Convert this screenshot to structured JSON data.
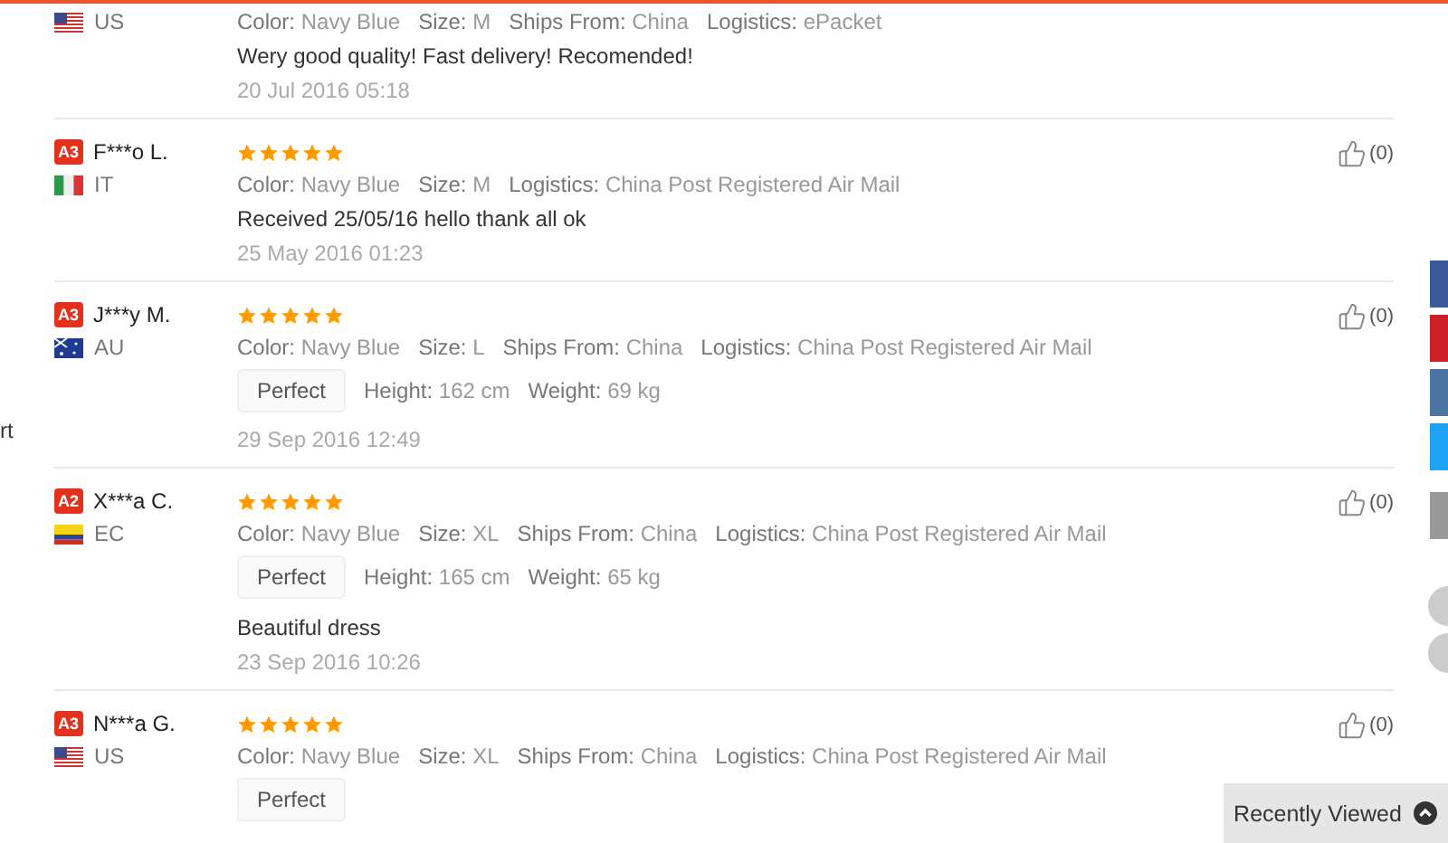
{
  "left_edge_text": "rt",
  "reviews": [
    {
      "country": "US",
      "flag": {
        "kind": "stars-and-stripes"
      },
      "attributes": [
        {
          "label": "Color:",
          "value": "Navy Blue"
        },
        {
          "label": "Size:",
          "value": "M"
        },
        {
          "label": "Ships From:",
          "value": "China"
        },
        {
          "label": "Logistics:",
          "value": "ePacket"
        }
      ],
      "text": "Wery good quality! Fast delivery! Recomended!",
      "date": "20 Jul 2016 05:18"
    },
    {
      "badge": "A3",
      "name": "F***o L.",
      "country": "IT",
      "flag": {
        "kind": "vertical-tricolor"
      },
      "stars": 5,
      "attributes": [
        {
          "label": "Color:",
          "value": "Navy Blue"
        },
        {
          "label": "Size:",
          "value": "M"
        },
        {
          "label": "Logistics:",
          "value": "China Post Registered Air Mail"
        }
      ],
      "text": "Received 25/05/16 hello thank all ok",
      "date": "25 May 2016 01:23",
      "likes": "(0)"
    },
    {
      "badge": "A3",
      "name": "J***y M.",
      "country": "AU",
      "flag": {
        "kind": "ensign"
      },
      "stars": 5,
      "attributes": [
        {
          "label": "Color:",
          "value": "Navy Blue"
        },
        {
          "label": "Size:",
          "value": "L"
        },
        {
          "label": "Ships From:",
          "value": "China"
        },
        {
          "label": "Logistics:",
          "value": "China Post Registered Air Mail"
        }
      ],
      "fit": "Perfect",
      "measurements": [
        {
          "label": "Height:",
          "value": "162 cm"
        },
        {
          "label": "Weight:",
          "value": "69 kg"
        }
      ],
      "date": "29 Sep 2016 12:49",
      "likes": "(0)"
    },
    {
      "badge": "A2",
      "name": "X***a C.",
      "country": "EC",
      "flag": {
        "kind": "horizontal-tricolor"
      },
      "stars": 5,
      "attributes": [
        {
          "label": "Color:",
          "value": "Navy Blue"
        },
        {
          "label": "Size:",
          "value": "XL"
        },
        {
          "label": "Ships From:",
          "value": "China"
        },
        {
          "label": "Logistics:",
          "value": "China Post Registered Air Mail"
        }
      ],
      "fit": "Perfect",
      "measurements": [
        {
          "label": "Height:",
          "value": "165 cm"
        },
        {
          "label": "Weight:",
          "value": "65 kg"
        }
      ],
      "text": "Beautiful dress",
      "date": "23 Sep 2016 10:26",
      "likes": "(0)"
    },
    {
      "badge": "A3",
      "name": "N***a G.",
      "country": "US",
      "flag": {
        "kind": "stars-and-stripes"
      },
      "stars": 5,
      "attributes": [
        {
          "label": "Color:",
          "value": "Navy Blue"
        },
        {
          "label": "Size:",
          "value": "XL"
        },
        {
          "label": "Ships From:",
          "value": "China"
        },
        {
          "label": "Logistics:",
          "value": "China Post Registered Air Mail"
        }
      ],
      "fit": "Perfect",
      "likes": "(0)"
    }
  ],
  "recently_viewed": {
    "label": "Recently Viewed"
  }
}
